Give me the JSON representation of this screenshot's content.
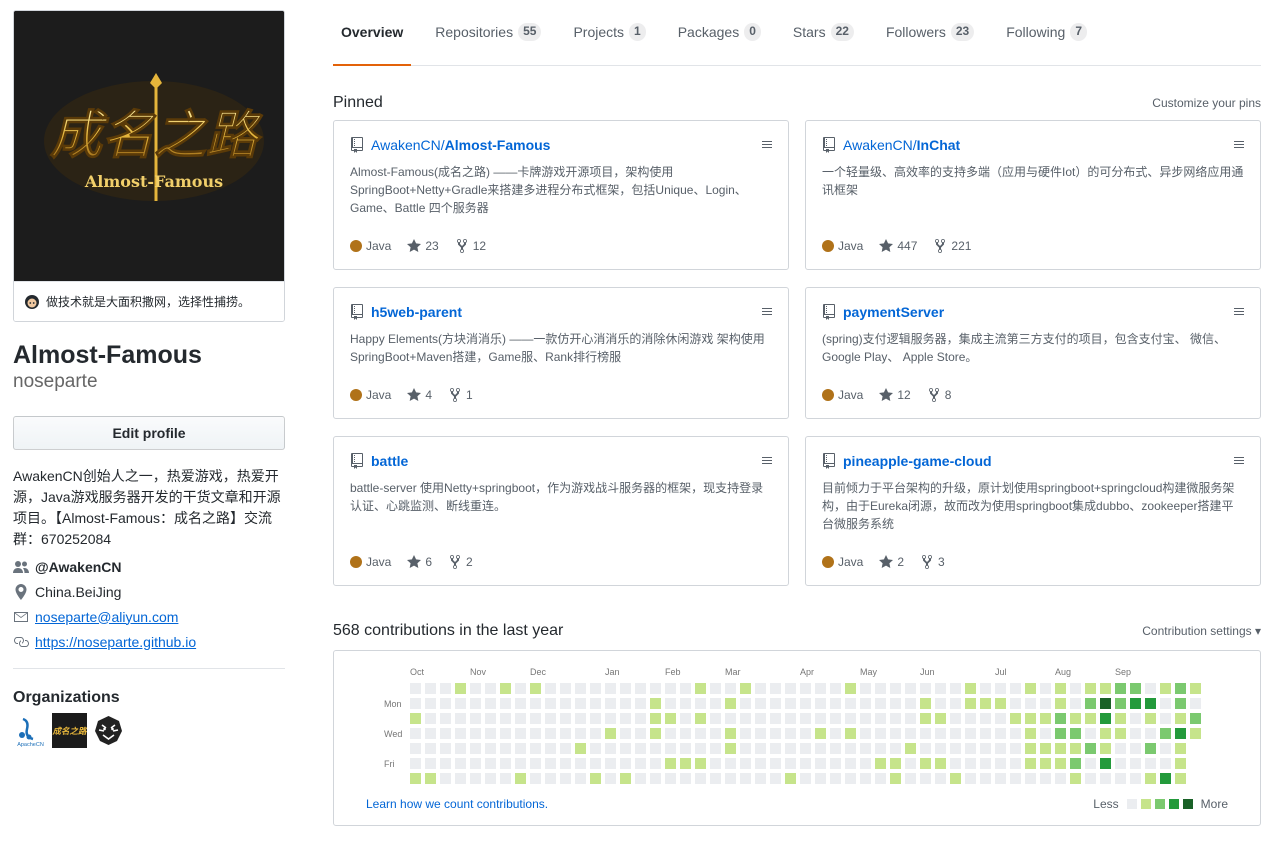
{
  "profile": {
    "avatar_text_cn": "成名之路",
    "avatar_text_en": "Almost-Famous",
    "status": "做技术就是大面积撒网，选择性捕捞。",
    "fullname": "Almost-Famous",
    "username": "noseparte",
    "edit_label": "Edit profile",
    "bio": "AwakenCN创始人之一，热爱游戏，热爱开源，Java游戏服务器开发的干货文章和开源项目。【Almost-Famous：成名之路】交流群：670252084",
    "org_handle": "@AwakenCN",
    "location": "China.BeiJing",
    "email": "noseparte@aliyun.com",
    "website": "https://noseparte.github.io",
    "orgs_title": "Organizations",
    "orgs": [
      {
        "name": "apachecn",
        "label": "ApacheCN"
      },
      {
        "name": "awakencn",
        "label": "成名之路"
      },
      {
        "name": "tiger-org",
        "label": ""
      }
    ]
  },
  "tabs": [
    {
      "label": "Overview",
      "count": ""
    },
    {
      "label": "Repositories",
      "count": "55"
    },
    {
      "label": "Projects",
      "count": "1"
    },
    {
      "label": "Packages",
      "count": "0"
    },
    {
      "label": "Stars",
      "count": "22"
    },
    {
      "label": "Followers",
      "count": "23"
    },
    {
      "label": "Following",
      "count": "7"
    }
  ],
  "pinned": {
    "title": "Pinned",
    "customize": "Customize your pins",
    "items": [
      {
        "owner": "AwakenCN/",
        "repo": "Almost-Famous",
        "desc": "Almost-Famous(成名之路) ——卡牌游戏开源项目，架构使用SpringBoot+Netty+Gradle来搭建多进程分布式框架，包括Unique、Login、Game、Battle 四个服务器",
        "lang": "Java",
        "stars": "23",
        "forks": "12"
      },
      {
        "owner": "AwakenCN/",
        "repo": "InChat",
        "desc": "一个轻量级、高效率的支持多端（应用与硬件Iot）的可分布式、异步网络应用通讯框架",
        "lang": "Java",
        "stars": "447",
        "forks": "221"
      },
      {
        "owner": "",
        "repo": "h5web-parent",
        "desc": "Happy Elements(方块消消乐) ——一款仿开心消消乐的消除休闲游戏 架构使用SpringBoot+Maven搭建，Game服、Rank排行榜服",
        "lang": "Java",
        "stars": "4",
        "forks": "1"
      },
      {
        "owner": "",
        "repo": "paymentServer",
        "desc": "(spring)支付逻辑服务器，集成主流第三方支付的项目，包含支付宝、 微信、Google Play、 Apple Store。",
        "lang": "Java",
        "stars": "12",
        "forks": "8"
      },
      {
        "owner": "",
        "repo": "battle",
        "desc": "battle-server 使用Netty+springboot，作为游戏战斗服务器的框架，现支持登录认证、心跳监测、断线重连。",
        "lang": "Java",
        "stars": "6",
        "forks": "2"
      },
      {
        "owner": "",
        "repo": "pineapple-game-cloud",
        "desc": "目前倾力于平台架构的升级，原计划使用springboot+springcloud构建微服务架构，由于Eureka闭源，故而改为使用springboot集成dubbo、zookeeper搭建平台微服务系统",
        "lang": "Java",
        "stars": "2",
        "forks": "3"
      }
    ]
  },
  "contributions": {
    "title": "568 contributions in the last year",
    "settings": "Contribution settings ▾",
    "months": [
      "Oct",
      "Nov",
      "Dec",
      "Jan",
      "Feb",
      "Mar",
      "Apr",
      "May",
      "Jun",
      "Jul",
      "Aug",
      "Sep"
    ],
    "days": [
      "Mon",
      "Wed",
      "Fri"
    ],
    "learn": "Learn how we count contributions.",
    "less": "Less",
    "more": "More",
    "colors": [
      "#ebedf0",
      "#c6e48b",
      "#7bc96f",
      "#239a3b",
      "#196127"
    ]
  }
}
